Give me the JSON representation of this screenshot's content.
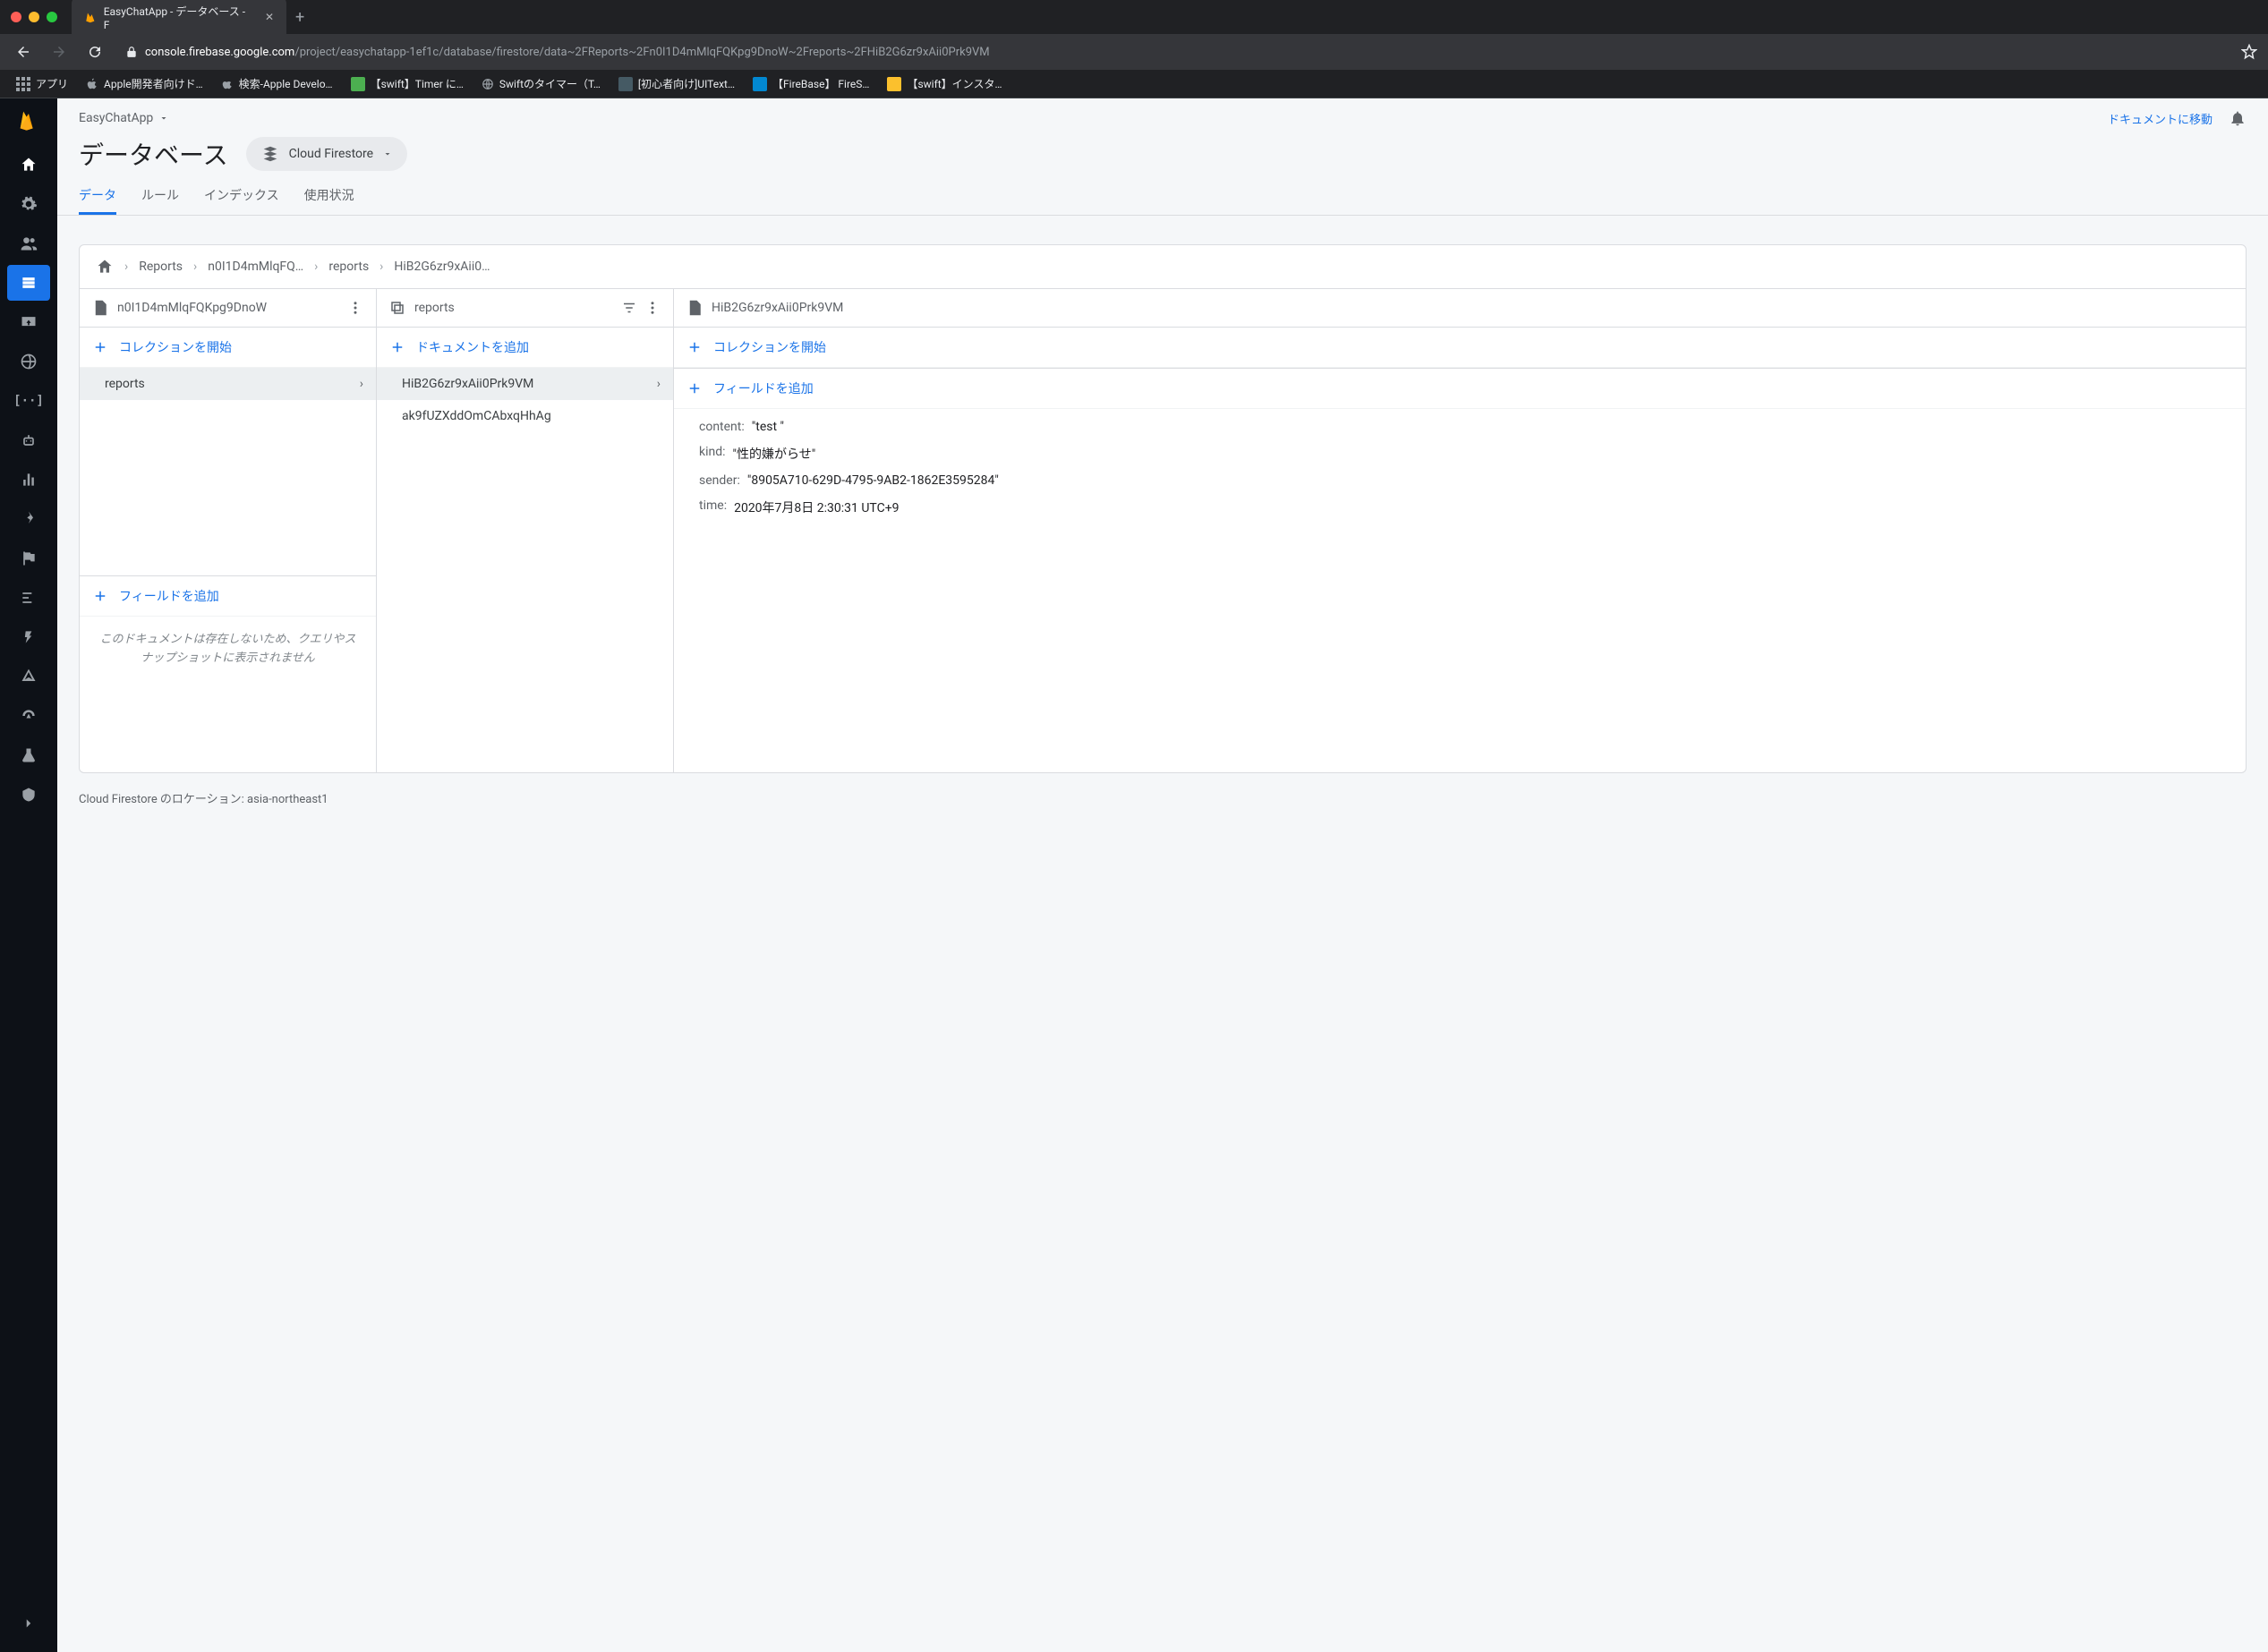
{
  "tab": {
    "title": "EasyChatApp - データベース - F"
  },
  "url": {
    "host": "console.firebase.google.com",
    "path": "/project/easychatapp-1ef1c/database/firestore/data~2FReports~2Fn0I1D4mMlqFQKpg9DnoW~2Freports~2FHiB2G6zr9xAii0Prk9VM"
  },
  "bookmarks": [
    {
      "label": "アプリ"
    },
    {
      "label": "Apple開発者向けド…"
    },
    {
      "label": "検索-Apple Develo…"
    },
    {
      "label": "【swift】Timer に…"
    },
    {
      "label": "Swiftのタイマー（T…"
    },
    {
      "label": "[初心者向け]UIText…"
    },
    {
      "label": "【FireBase】 FireS…"
    },
    {
      "label": "【swift】インスタ…"
    }
  ],
  "header": {
    "project": "EasyChatApp",
    "go_to_docs": "ドキュメントに移動"
  },
  "title": {
    "page": "データベース",
    "selector": "Cloud Firestore"
  },
  "tabs": [
    "データ",
    "ルール",
    "インデックス",
    "使用状況"
  ],
  "breadcrumbs": [
    "Reports",
    "n0I1D4mMlqFQ…",
    "reports",
    "HiB2G6zr9xAii0…"
  ],
  "col1": {
    "title": "n0I1D4mMlqFQKpg9DnoW",
    "add_collection": "コレクションを開始",
    "items": [
      "reports"
    ],
    "add_field": "フィールドを追加",
    "empty": "このドキュメントは存在しないため、クエリやスナップショットに表示されません"
  },
  "col2": {
    "title": "reports",
    "add_document": "ドキュメントを追加",
    "items": [
      "HiB2G6zr9xAii0Prk9VM",
      "ak9fUZXddOmCAbxqHhAg"
    ]
  },
  "col3": {
    "title": "HiB2G6zr9xAii0Prk9VM",
    "add_collection": "コレクションを開始",
    "add_field": "フィールドを追加",
    "fields": [
      {
        "key": "content",
        "value": "\"test \""
      },
      {
        "key": "kind",
        "value": "\"性的嫌がらせ\""
      },
      {
        "key": "sender",
        "value": "\"8905A710-629D-4795-9AB2-1862E3595284\""
      },
      {
        "key": "time",
        "value": "2020年7月8日 2:30:31 UTC+9"
      }
    ]
  },
  "footer": "Cloud Firestore のロケーション: asia-northeast1"
}
